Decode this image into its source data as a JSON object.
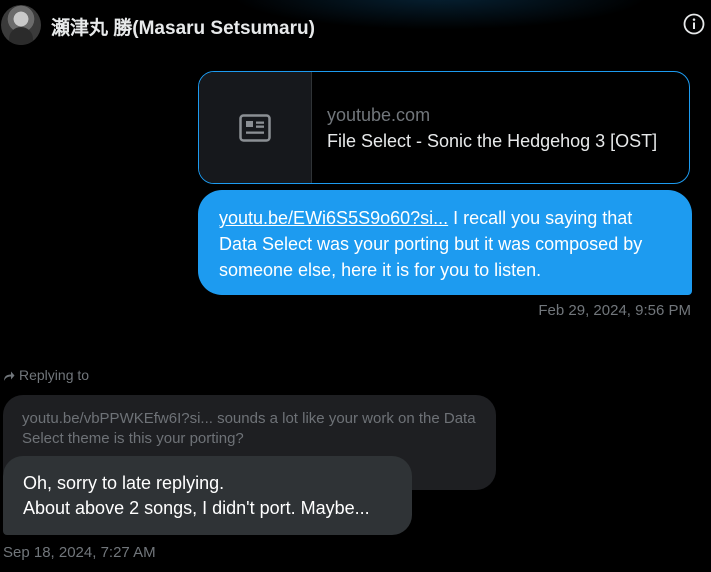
{
  "header": {
    "title": "瀬津丸 勝(Masaru Setsumaru)",
    "avatar_icon": "user-avatar",
    "info_icon": "info-icon"
  },
  "link_card": {
    "domain": "youtube.com",
    "title": "File Select - Sonic the Hedgehog 3 [OST]",
    "thumb_icon": "article-icon"
  },
  "sent_message": {
    "link_text": "youtu.be/EWi6S5S9o60?si...",
    "text": " I recall you saying that Data Select was your porting but it was composed by someone else, here it is for you to listen.",
    "timestamp": "Feb 29, 2024, 9:56 PM"
  },
  "reply": {
    "label": "Replying to",
    "icon": "reply-arrow-icon",
    "quoted_text": "youtu.be/vbPPWKEfw6I?si... sounds a lot like your work on the Data Select theme is this your porting?"
  },
  "received_message": {
    "line1": "Oh, sorry to late replying.",
    "line2": "About above 2 songs, I didn't port. Maybe...",
    "timestamp": "Sep 18, 2024, 7:27 AM"
  },
  "colors": {
    "accent": "#1d9bf0",
    "background": "#000000",
    "received_bubble": "#2f3336",
    "muted_text": "#71767b"
  }
}
